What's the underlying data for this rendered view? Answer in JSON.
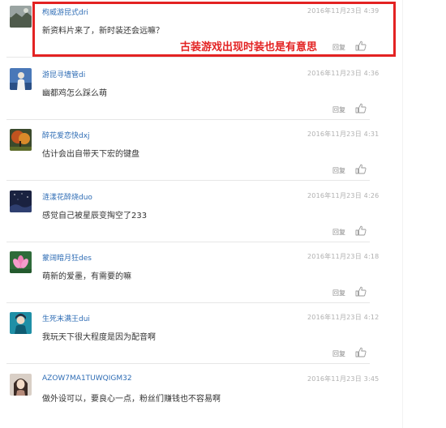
{
  "comments": [
    {
      "username": "枸威游昆式dri",
      "timestamp": "2016年11月23日 4:39",
      "text": "新资料片来了，新时装还会远嘛？",
      "reply_label": "回复",
      "avatar_icon": "avatar-landscape"
    },
    {
      "username": "游昆寻墙管di",
      "timestamp": "2016年11月23日 4:36",
      "text": "幽都鸡怎么踩么萌",
      "reply_label": "回复",
      "avatar_icon": "avatar-figure"
    },
    {
      "username": "醉花爱恋快dxj",
      "timestamp": "2016年11月23日 4:31",
      "text": "估计会出自带天下宏的键盘",
      "reply_label": "回复",
      "avatar_icon": "avatar-autumn-tree"
    },
    {
      "username": "涟漾花醉烧duo",
      "timestamp": "2016年11月23日 4:26",
      "text": "感觉自己被星辰变掏空了233",
      "reply_label": "回复",
      "avatar_icon": "avatar-night-sky"
    },
    {
      "username": "蒙阔暗月狂des",
      "timestamp": "2016年11月23日 4:18",
      "text": "萌新的爱墨，有需要的嘛",
      "reply_label": "回复",
      "avatar_icon": "avatar-lotus"
    },
    {
      "username": "生死末满王dui",
      "timestamp": "2016年11月23日 4:12",
      "text": "我玩天下很大程度是因为配音啊",
      "reply_label": "回复",
      "avatar_icon": "avatar-character"
    },
    {
      "username": "AZOW7MA1TUWQIGM32",
      "timestamp": "2016年11月23日 3:45",
      "text": "做外设可以，要良心一点，粉丝们赚钱也不容易啊",
      "reply_label": "回复",
      "avatar_icon": "avatar-girl"
    }
  ],
  "annotation": {
    "text": "古装游戏出现时装也是有意思"
  },
  "colors": {
    "annotation": "#e32222",
    "username": "#2f6db5"
  }
}
